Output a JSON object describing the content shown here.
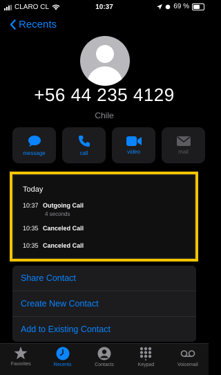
{
  "status": {
    "carrier": "CLARO CL",
    "time": "10:37",
    "battery": "69 %"
  },
  "nav": {
    "back_label": "Recents"
  },
  "contact": {
    "number": "+56 44 235 4129",
    "country": "Chile"
  },
  "actions": [
    {
      "label": "message",
      "icon": "message-icon"
    },
    {
      "label": "call",
      "icon": "phone-icon"
    },
    {
      "label": "video",
      "icon": "video-icon"
    },
    {
      "label": "mail",
      "icon": "mail-icon"
    }
  ],
  "history": {
    "section": "Today",
    "calls": [
      {
        "time": "10:37",
        "type": "Outgoing Call",
        "detail": "4 seconds"
      },
      {
        "time": "10:35",
        "type": "Canceled Call"
      },
      {
        "time": "10:35",
        "type": "Canceled Call"
      }
    ]
  },
  "links": [
    "Share Contact",
    "Create New Contact",
    "Add to Existing Contact"
  ],
  "tabs": [
    {
      "label": "Favorites",
      "icon": "star-icon"
    },
    {
      "label": "Recents",
      "icon": "clock-icon"
    },
    {
      "label": "Contacts",
      "icon": "person-icon"
    },
    {
      "label": "Keypad",
      "icon": "keypad-icon"
    },
    {
      "label": "Voicemail",
      "icon": "voicemail-icon"
    }
  ],
  "colors": {
    "accent": "#0a84ff",
    "highlight": "#f5c400",
    "background": "#000000",
    "card": "#1c1c1e"
  }
}
